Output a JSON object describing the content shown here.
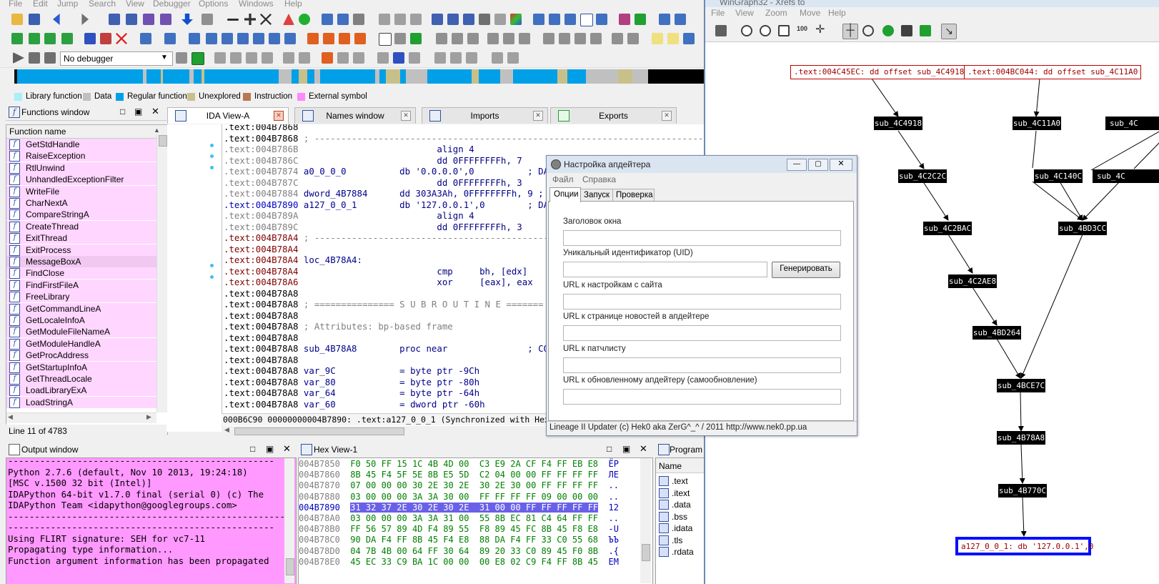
{
  "ida": {
    "menu": [
      "File",
      "Edit",
      "Jump",
      "Search",
      "View",
      "Debugger",
      "Options",
      "Windows",
      "Help"
    ],
    "debugger_select": "No debugger",
    "legend": [
      {
        "label": "Library function",
        "color": "#a8f0f8"
      },
      {
        "label": "Data",
        "color": "#c0c0c0"
      },
      {
        "label": "Regular function",
        "color": "#00a0e8"
      },
      {
        "label": "Unexplored",
        "color": "#c8c08a"
      },
      {
        "label": "Instruction",
        "color": "#b87850"
      },
      {
        "label": "External symbol",
        "color": "#ff88ff"
      }
    ],
    "functions_window": {
      "title": "Functions window",
      "column": "Function name",
      "items": [
        "GetStdHandle",
        "RaiseException",
        "RtlUnwind",
        "UnhandledExceptionFilter",
        "WriteFile",
        "CharNextA",
        "CompareStringA",
        "CreateThread",
        "ExitThread",
        "ExitProcess",
        "MessageBoxA",
        "FindClose",
        "FindFirstFileA",
        "FreeLibrary",
        "GetCommandLineA",
        "GetLocaleInfoA",
        "GetModuleFileNameA",
        "GetModuleHandleA",
        "GetProcAddress",
        "GetStartupInfoA",
        "GetThreadLocale",
        "LoadLibraryExA",
        "LoadStringA"
      ],
      "status": "Line 11 of 4783"
    },
    "tabs": [
      "IDA View-A",
      "Names window",
      "Imports",
      "Exports"
    ],
    "disasm": [
      {
        "a": ".text:004B7868",
        "c": ""
      },
      {
        "a": ".text:004B7868",
        "c": " ; ---------------------------------------------------------------------------"
      },
      {
        "a": ".text:004B786B",
        "c": "                          align 4"
      },
      {
        "a": ".text:004B786C",
        "c": "                          dd 0FFFFFFFFh, 7"
      },
      {
        "a": ".text:004B7874",
        "c": " a0_0_0_0          db '0.0.0.0',0          ; DA"
      },
      {
        "a": ".text:004B787C",
        "c": "                          dd 0FFFFFFFFh, 3"
      },
      {
        "a": ".text:004B7884",
        "c": " dword_4B7884      dd 303A3Ah, 0FFFFFFFFh, 9 ;"
      },
      {
        "a": ".text:004B7890",
        "c": " a127_0_0_1        db '127.0.0.1',0        ; DA"
      },
      {
        "a": ".text:004B789A",
        "c": "                          align 4"
      },
      {
        "a": ".text:004B789C",
        "c": "                          dd 0FFFFFFFFh, 3"
      },
      {
        "a": ".text:004B78A4",
        "c": " ; ---------------------------------------------------------------------------"
      },
      {
        "a": ".text:004B78A4",
        "c": ""
      },
      {
        "a": ".text:004B78A4",
        "c": " loc_4B78A4:                                   ; DA"
      },
      {
        "a": ".text:004B78A4",
        "c": "                          cmp     bh, [edx]"
      },
      {
        "a": ".text:004B78A6",
        "c": "                          xor     [eax], eax"
      },
      {
        "a": ".text:004B78A8",
        "c": ""
      },
      {
        "a": ".text:004B78A8",
        "c": " ; =============== S U B R O U T I N E ======="
      },
      {
        "a": ".text:004B78A8",
        "c": ""
      },
      {
        "a": ".text:004B78A8",
        "c": " ; Attributes: bp-based frame"
      },
      {
        "a": ".text:004B78A8",
        "c": ""
      },
      {
        "a": ".text:004B78A8",
        "c": " sub_4B78A8        proc near               ; CO"
      },
      {
        "a": ".text:004B78A8",
        "c": ""
      },
      {
        "a": ".text:004B78A8",
        "c": " var_9C            = byte ptr -9Ch"
      },
      {
        "a": ".text:004B78A8",
        "c": " var_80            = byte ptr -80h"
      },
      {
        "a": ".text:004B78A8",
        "c": " var_64            = byte ptr -64h"
      },
      {
        "a": ".text:004B78A8",
        "c": " var_60            = dword ptr -60h"
      }
    ],
    "sync_status": "000B6C90 00000000004B7890: .text:a127_0_0_1 (Synchronized with Hex View-1)",
    "output_window": {
      "title": "Output window",
      "lines": [
        "--------------------------------------------------",
        "Python 2.7.6 (default, Nov 10 2013, 19:24:18)",
        "[MSC v.1500 32 bit (Intel)]",
        "IDAPython 64-bit v1.7.0 final (serial 0) (c) The",
        "IDAPython Team <idapython@googlegroups.com>",
        "-----------------------------------------------------",
        "--------------------------------------------------",
        "Using FLIRT signature: SEH for vc7-11",
        "Propagating type information...",
        "Function argument information has been propagated"
      ]
    },
    "hex_view": {
      "title": "Hex View-1",
      "rows": [
        {
          "addr": "004B7850",
          "hex": "F0 50 FF 15 1C 4B 4D 00  C3 E9 2A CF F4 FF EB E8",
          "asc": "ЁР"
        },
        {
          "addr": "004B7860",
          "hex": "8B 45 F4 5F 5E 8B E5 5D  C2 04 00 00 FF FF FF FF",
          "asc": "ЛЕ"
        },
        {
          "addr": "004B7870",
          "hex": "07 00 00 00 30 2E 30 2E  30 2E 30 00 FF FF FF FF",
          "asc": ".."
        },
        {
          "addr": "004B7880",
          "hex": "03 00 00 00 3A 3A 30 00  FF FF FF FF 09 00 00 00",
          "asc": ".."
        },
        {
          "addr": "004B7890",
          "hex": "31 32 37 2E 30 2E 30 2E  31 00 00 FF FF FF FF FF",
          "asc": "12"
        },
        {
          "addr": "004B78A0",
          "hex": "03 00 00 00 3A 3A 31 00  55 8B EC 81 C4 64 FF FF",
          "asc": ".."
        },
        {
          "addr": "004B78B0",
          "hex": "FF 56 57 89 4D F4 89 55  F8 89 45 FC 8B 45 F8 E8",
          "asc": "-U"
        },
        {
          "addr": "004B78C0",
          "hex": "90 DA F4 FF 8B 45 F4 E8  88 DA F4 FF 33 C0 55 68",
          "asc": "ЪЪ"
        },
        {
          "addr": "004B78D0",
          "hex": "04 7B 4B 00 64 FF 30 64  89 20 33 C0 89 45 F0 8B",
          "asc": ".{"
        },
        {
          "addr": "004B78E0",
          "hex": "45 EC 33 C9 BA 1C 00 00  00 E8 02 C9 F4 FF 8B 45",
          "asc": "EM"
        }
      ]
    },
    "program_segments": {
      "title": "Program",
      "column": "Name",
      "items": [
        ".text",
        ".itext",
        ".data",
        ".bss",
        ".idata",
        ".tls",
        ".rdata"
      ]
    }
  },
  "wingraph": {
    "title": "WinGraph32 - Xrefs to",
    "menu": [
      "File",
      "View",
      "Zoom",
      "Move",
      "Help"
    ],
    "text_nodes": [
      ".text:004C45EC: dd offset sub_4C4918",
      ".text:004BC044: dd offset sub_4C11A0"
    ],
    "nodes": [
      "sub_4C4918",
      "sub_4C11A0",
      "sub_4C2C2C",
      "sub_4C140C",
      "sub_4C2BAC",
      "sub_4BD3CC",
      "sub_4C2AE8",
      "sub_4BD264",
      "sub_4BCE7C",
      "sub_4B78A8",
      "sub_4B770C",
      "sub_4C",
      "sub_4C"
    ],
    "target": "a127_0_0_1: db '127.0.0.1',0"
  },
  "dialog": {
    "title": "Настройка апдейтера",
    "menu": [
      "Файл",
      "Справка"
    ],
    "tabs": [
      "Опции",
      "Запуск",
      "Проверка"
    ],
    "labels": {
      "window_title": "Заголовок окна",
      "uid": "Уникальный идентификатор (UID)",
      "settings_url": "URL к настройкам с сайта",
      "news_url": "URL к странице новостей в апдейтере",
      "patchlist_url": "URL к патчлисту",
      "self_update_url": "URL к обновленному апдейтеру (самообновление)"
    },
    "generate_button": "Генерировать",
    "footer": "Lineage II Updater (c) Hek0 aka ZerG^_^ / 2011 http://www.nek0.pp.ua"
  }
}
